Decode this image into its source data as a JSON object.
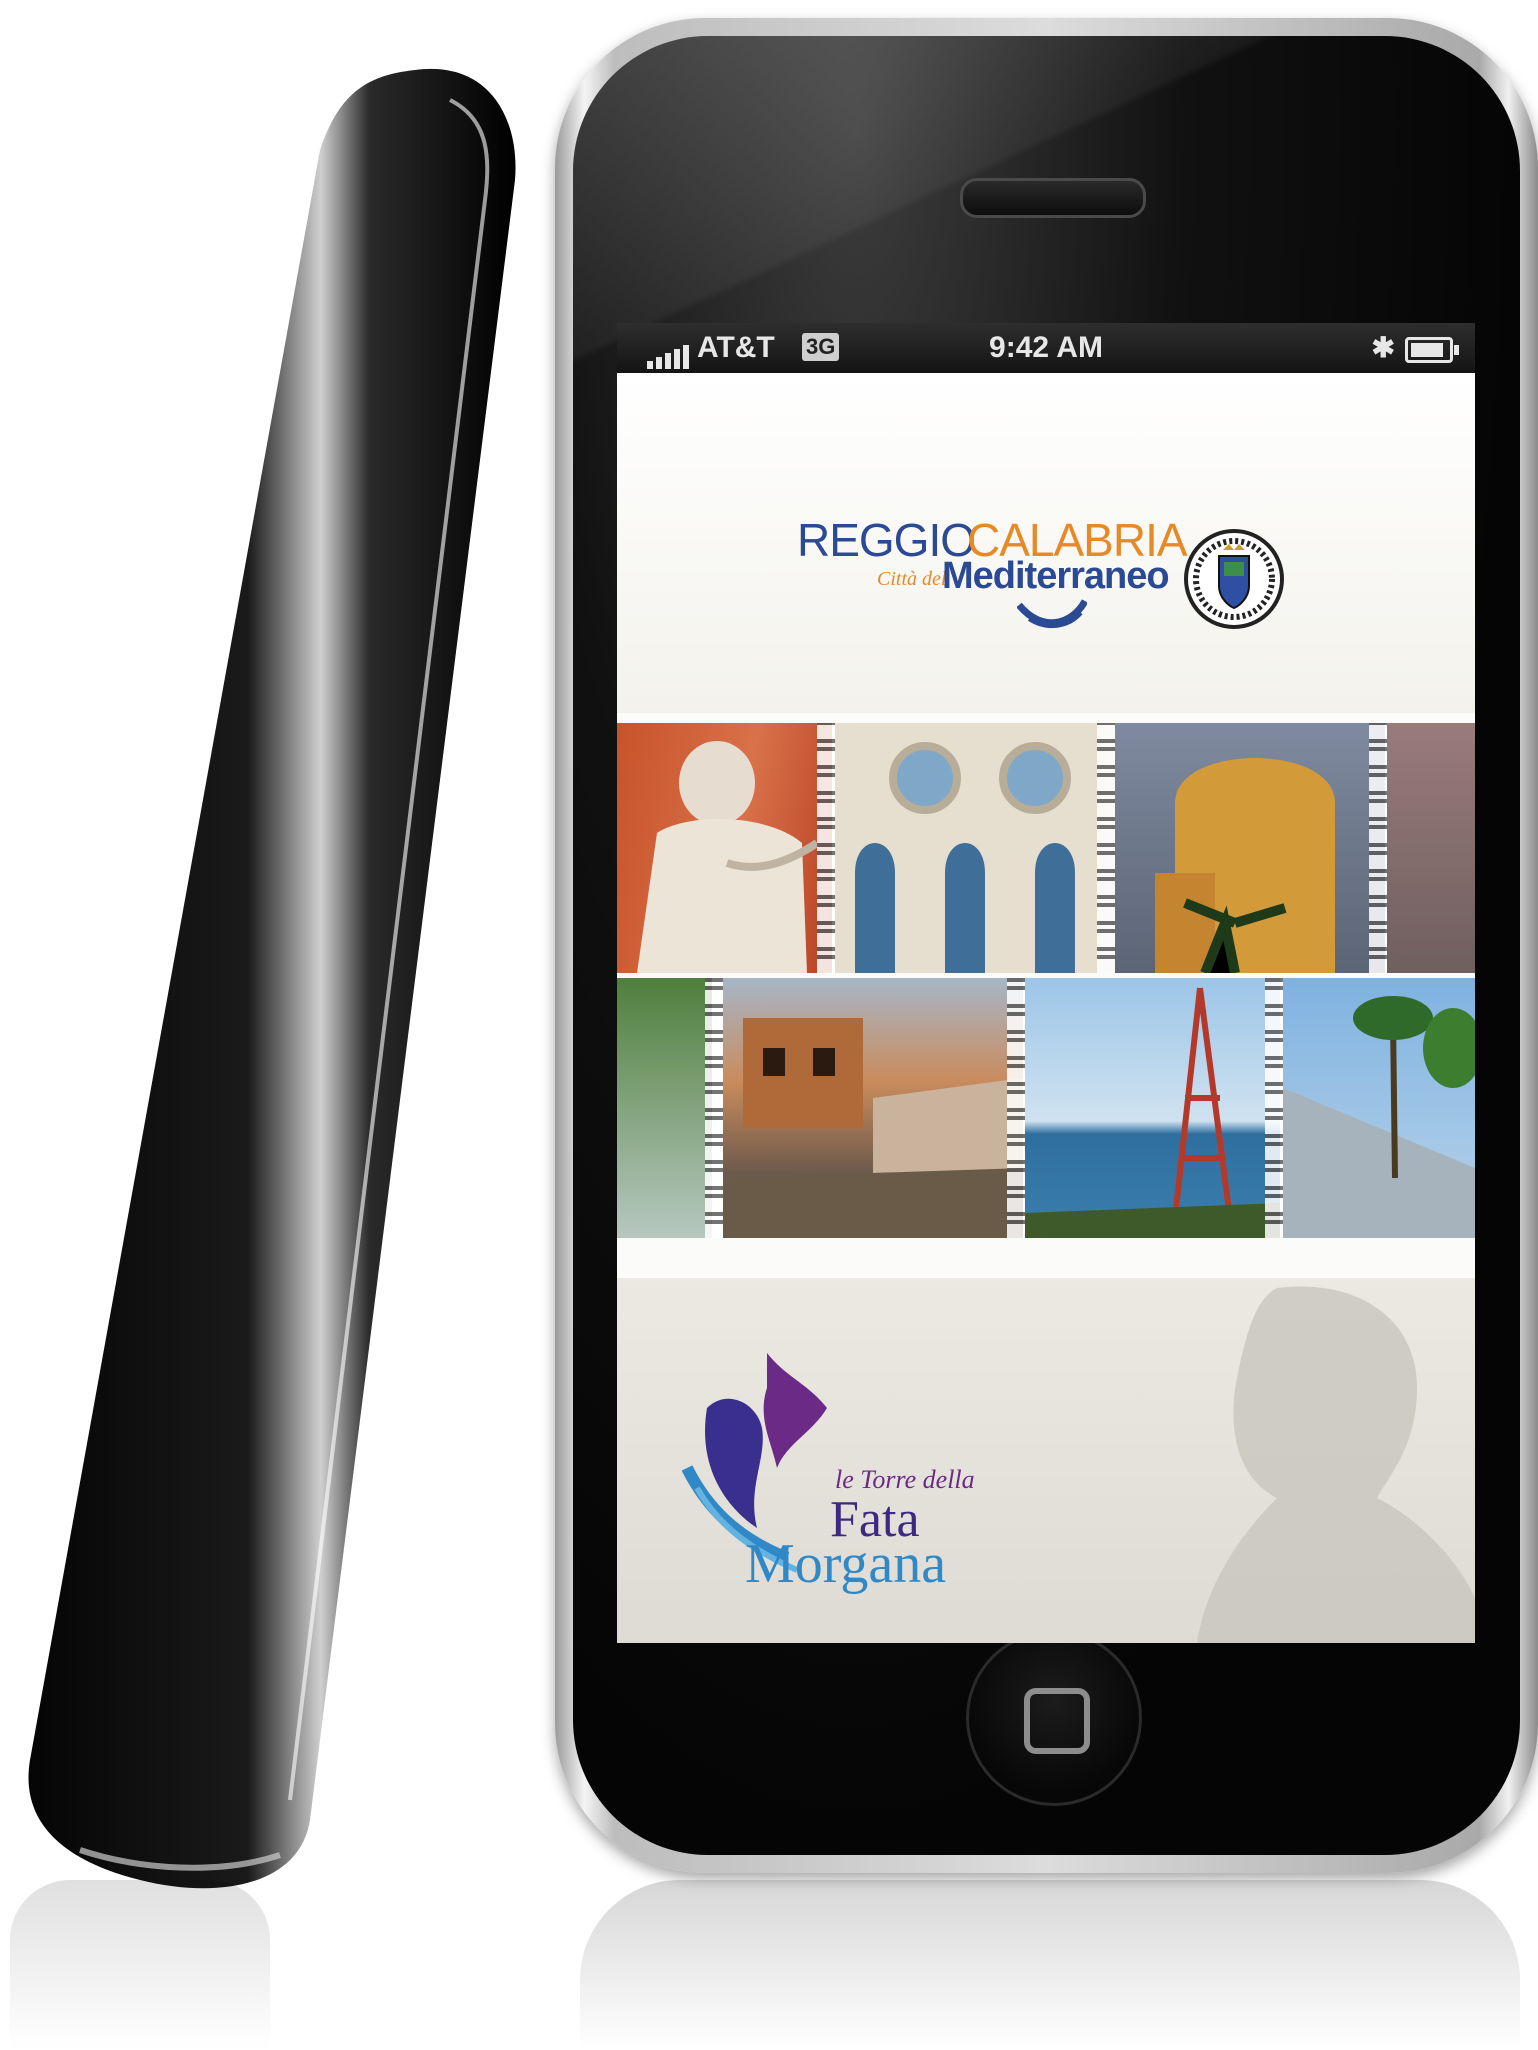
{
  "status_bar": {
    "carrier": "AT&T",
    "network": "3G",
    "time": "9:42 AM"
  },
  "header": {
    "brand_part1": "REGGIO",
    "brand_part2": "CALABRIA",
    "tagline_prefix": "Città del",
    "tagline_main": "Mediterraneo"
  },
  "footer": {
    "logo_small": "le Torre della",
    "logo_main": "Fata",
    "logo_second": "Morgana"
  },
  "icons": [
    "signal-icon",
    "bluetooth-icon",
    "battery-icon",
    "emblem-icon",
    "home-button-icon"
  ],
  "colors": {
    "brand_blue": "#2b4a94",
    "brand_orange": "#e68a28",
    "fata_purple": "#3d2a80",
    "fata_blue": "#3188c6"
  }
}
